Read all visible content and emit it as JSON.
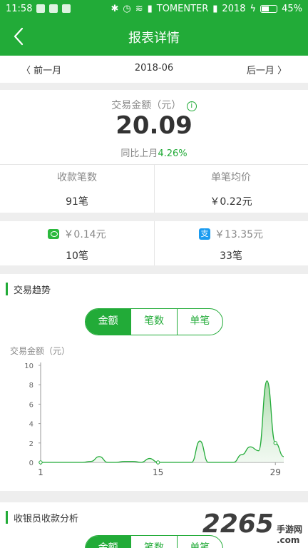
{
  "status_bar": {
    "time": "11:58",
    "carrier": "TOMENTER",
    "carrier2": "2018",
    "battery": "45%"
  },
  "header": {
    "title": "报表详情"
  },
  "date_nav": {
    "prev_label": "前一月",
    "month": "2018-06",
    "next_label": "后一月"
  },
  "summary": {
    "amount_label": "交易金额（元）",
    "amount": "20.09",
    "mom_prefix": "同比上月",
    "mom_pct": "4.26%",
    "count_label": "收款笔数",
    "count_value": "91笔",
    "avg_label": "单笔均价",
    "avg_value": "￥0.22元"
  },
  "channels": {
    "wechat_amount": "￥0.14元",
    "wechat_count": "10笔",
    "alipay_amount": "￥13.35元",
    "alipay_count": "33笔",
    "alipay_glyph": "支"
  },
  "trend": {
    "title": "交易趋势",
    "tabs": [
      "金额",
      "笔数",
      "单笔"
    ],
    "active_tab": 0,
    "ylabel": "交易金额（元）"
  },
  "cashier": {
    "title": "收银员收款分析",
    "tabs": [
      "金额",
      "笔数",
      "单笔"
    ]
  },
  "watermark": {
    "number": "2265",
    "text": "手游网",
    "url": ".com"
  },
  "colors": {
    "brand": "#22ab38",
    "chart_fill": "#cfe9cf"
  },
  "chart_data": {
    "type": "area",
    "title": "",
    "ylabel": "交易金额（元）",
    "xlabel": "",
    "ylim": [
      0,
      10
    ],
    "yticks": [
      0,
      2,
      4,
      6,
      8,
      10
    ],
    "xticks": [
      1,
      15,
      29
    ],
    "xlim": [
      1,
      30
    ],
    "x": [
      1,
      2,
      3,
      4,
      5,
      6,
      7,
      8,
      9,
      10,
      11,
      12,
      13,
      14,
      15,
      16,
      17,
      18,
      19,
      20,
      21,
      22,
      23,
      24,
      25,
      26,
      27,
      28,
      29,
      30
    ],
    "series": [
      {
        "values": [
          0,
          0,
          0,
          0,
          0,
          0,
          0.1,
          0.6,
          0,
          0,
          0.1,
          0.1,
          0,
          0.4,
          0,
          0,
          0,
          0,
          0,
          2.2,
          0,
          0,
          0,
          0,
          0.8,
          1.6,
          1.2,
          8.4,
          2.0,
          0.6
        ]
      }
    ]
  }
}
